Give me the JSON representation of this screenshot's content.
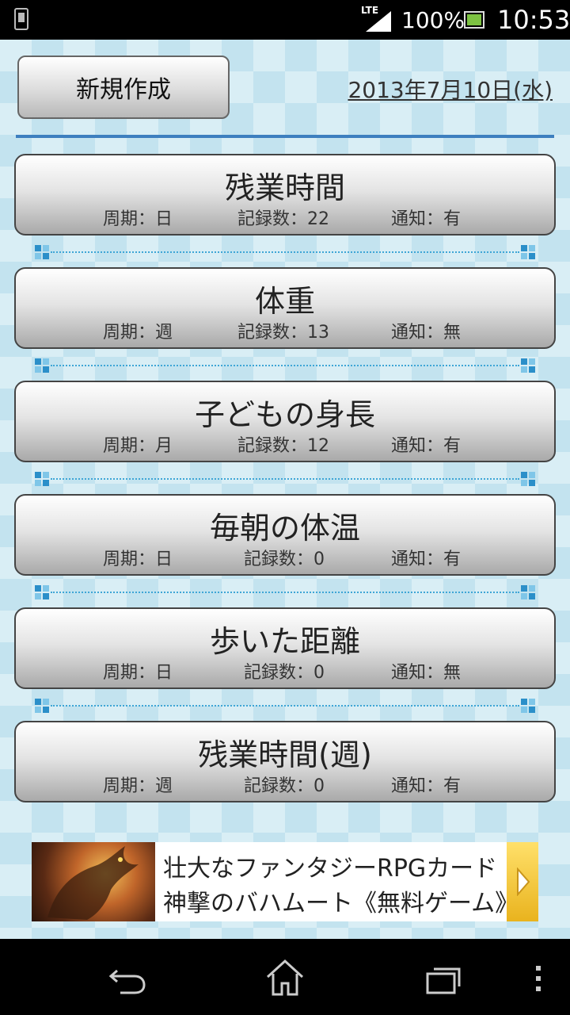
{
  "status_bar": {
    "network": "LTE",
    "battery_percent": "100%",
    "time": "10:53",
    "icons": [
      "phone-icon",
      "signal-icon",
      "battery-icon"
    ]
  },
  "header": {
    "new_button_label": "新規作成",
    "date": "2013年7月10日(水)"
  },
  "items": [
    {
      "title": "残業時間",
      "cycle": "周期：日",
      "records": "記録数：22",
      "notify": "通知：有"
    },
    {
      "title": "体重",
      "cycle": "周期：週",
      "records": "記録数：13",
      "notify": "通知：無"
    },
    {
      "title": "子どもの身長",
      "cycle": "周期：月",
      "records": "記録数：12",
      "notify": "通知：有"
    },
    {
      "title": "毎朝の体温",
      "cycle": "周期：日",
      "records": "記録数：0",
      "notify": "通知：有"
    },
    {
      "title": "歩いた距離",
      "cycle": "周期：日",
      "records": "記録数：0",
      "notify": "通知：無"
    },
    {
      "title": "残業時間(週)",
      "cycle": "周期：週",
      "records": "記録数：0",
      "notify": "通知：有"
    }
  ],
  "ad": {
    "line1": "壮大なファンタジーRPGカード",
    "line2": "神撃のバハムート《無料ゲーム》"
  },
  "nav": {
    "icons": [
      "back-icon",
      "home-icon",
      "recent-apps-icon",
      "menu-icon"
    ]
  },
  "colors": {
    "accent_rule": "#3d7fbf",
    "background": "#d9eef5"
  }
}
